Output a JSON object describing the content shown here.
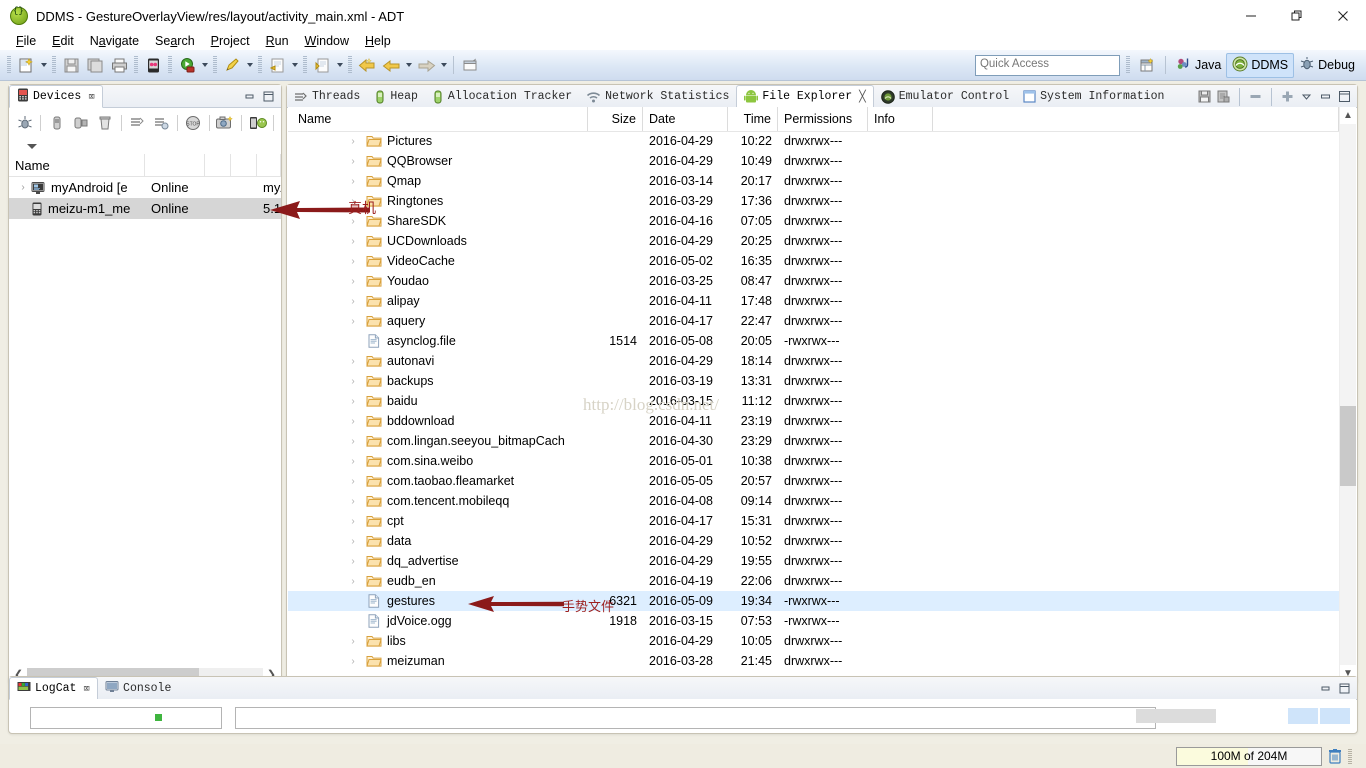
{
  "window": {
    "title": "DDMS - GestureOverlayView/res/layout/activity_main.xml - ADT",
    "minimize": "—",
    "maximize": "❐",
    "close": "✕"
  },
  "menu": [
    {
      "label": "File"
    },
    {
      "label": "Edit"
    },
    {
      "label": "Navigate"
    },
    {
      "label": "Search"
    },
    {
      "label": "Project"
    },
    {
      "label": "Run"
    },
    {
      "label": "Window"
    },
    {
      "label": "Help"
    }
  ],
  "toolbar": {
    "quick_access_placeholder": "Quick Access",
    "perspectives": [
      {
        "label": "Java",
        "active": false,
        "icon": "java-perspective-icon"
      },
      {
        "label": "DDMS",
        "active": true,
        "icon": "ddms-perspective-icon"
      },
      {
        "label": "Debug",
        "active": false,
        "icon": "debug-perspective-icon"
      }
    ]
  },
  "devices_view": {
    "tab_label": "Devices",
    "close_glyph": "⌧",
    "columns": [
      "Name",
      "",
      "",
      "",
      ""
    ],
    "rows": [
      {
        "name": "myAndroid [e",
        "status": "Online",
        "col3": "",
        "col4": "",
        "info": "myA",
        "twisty": "›",
        "icon": "emulator-icon",
        "selected": false
      },
      {
        "name": "meizu-m1_me",
        "status": "Online",
        "col3": "",
        "col4": "",
        "info": "5.1",
        "twisty": "",
        "icon": "phone-icon",
        "selected": true
      }
    ]
  },
  "explorer_view": {
    "tabs": [
      {
        "label": "Threads",
        "icon": "threads-icon",
        "active": false
      },
      {
        "label": "Heap",
        "icon": "heap-icon",
        "active": false
      },
      {
        "label": "Allocation Tracker",
        "icon": "allocation-icon",
        "active": false
      },
      {
        "label": "Network Statistics",
        "icon": "network-icon",
        "active": false
      },
      {
        "label": "File Explorer",
        "icon": "android-icon",
        "active": true
      },
      {
        "label": "Emulator Control",
        "icon": "emulator-control-icon",
        "active": false
      },
      {
        "label": "System Information",
        "icon": "system-info-icon",
        "active": false
      }
    ],
    "columns": {
      "name": "Name",
      "size": "Size",
      "date": "Date",
      "time": "Time",
      "permissions": "Permissions",
      "info": "Info"
    },
    "rows": [
      {
        "name": "Pictures",
        "size": "",
        "date": "2016-04-29",
        "time": "10:22",
        "perm": "drwxrwx---",
        "type": "folder",
        "selected": false
      },
      {
        "name": "QQBrowser",
        "size": "",
        "date": "2016-04-29",
        "time": "10:49",
        "perm": "drwxrwx---",
        "type": "folder",
        "selected": false
      },
      {
        "name": "Qmap",
        "size": "",
        "date": "2016-03-14",
        "time": "20:17",
        "perm": "drwxrwx---",
        "type": "folder",
        "selected": false
      },
      {
        "name": "Ringtones",
        "size": "",
        "date": "2016-03-29",
        "time": "17:36",
        "perm": "drwxrwx---",
        "type": "folder",
        "selected": false
      },
      {
        "name": "ShareSDK",
        "size": "",
        "date": "2016-04-16",
        "time": "07:05",
        "perm": "drwxrwx---",
        "type": "folder",
        "selected": false
      },
      {
        "name": "UCDownloads",
        "size": "",
        "date": "2016-04-29",
        "time": "20:25",
        "perm": "drwxrwx---",
        "type": "folder",
        "selected": false
      },
      {
        "name": "VideoCache",
        "size": "",
        "date": "2016-05-02",
        "time": "16:35",
        "perm": "drwxrwx---",
        "type": "folder",
        "selected": false
      },
      {
        "name": "Youdao",
        "size": "",
        "date": "2016-03-25",
        "time": "08:47",
        "perm": "drwxrwx---",
        "type": "folder",
        "selected": false
      },
      {
        "name": "alipay",
        "size": "",
        "date": "2016-04-11",
        "time": "17:48",
        "perm": "drwxrwx---",
        "type": "folder",
        "selected": false
      },
      {
        "name": "aquery",
        "size": "",
        "date": "2016-04-17",
        "time": "22:47",
        "perm": "drwxrwx---",
        "type": "folder",
        "selected": false
      },
      {
        "name": "asynclog.file",
        "size": "1514",
        "date": "2016-05-08",
        "time": "20:05",
        "perm": "-rwxrwx---",
        "type": "file",
        "selected": false
      },
      {
        "name": "autonavi",
        "size": "",
        "date": "2016-04-29",
        "time": "18:14",
        "perm": "drwxrwx---",
        "type": "folder",
        "selected": false
      },
      {
        "name": "backups",
        "size": "",
        "date": "2016-03-19",
        "time": "13:31",
        "perm": "drwxrwx---",
        "type": "folder",
        "selected": false
      },
      {
        "name": "baidu",
        "size": "",
        "date": "2016-03-15",
        "time": "11:12",
        "perm": "drwxrwx---",
        "type": "folder",
        "selected": false
      },
      {
        "name": "bddownload",
        "size": "",
        "date": "2016-04-11",
        "time": "23:19",
        "perm": "drwxrwx---",
        "type": "folder",
        "selected": false
      },
      {
        "name": "com.lingan.seeyou_bitmapCach",
        "size": "",
        "date": "2016-04-30",
        "time": "23:29",
        "perm": "drwxrwx---",
        "type": "folder",
        "selected": false
      },
      {
        "name": "com.sina.weibo",
        "size": "",
        "date": "2016-05-01",
        "time": "10:38",
        "perm": "drwxrwx---",
        "type": "folder",
        "selected": false
      },
      {
        "name": "com.taobao.fleamarket",
        "size": "",
        "date": "2016-05-05",
        "time": "20:57",
        "perm": "drwxrwx---",
        "type": "folder",
        "selected": false
      },
      {
        "name": "com.tencent.mobileqq",
        "size": "",
        "date": "2016-04-08",
        "time": "09:14",
        "perm": "drwxrwx---",
        "type": "folder",
        "selected": false
      },
      {
        "name": "cpt",
        "size": "",
        "date": "2016-04-17",
        "time": "15:31",
        "perm": "drwxrwx---",
        "type": "folder",
        "selected": false
      },
      {
        "name": "data",
        "size": "",
        "date": "2016-04-29",
        "time": "10:52",
        "perm": "drwxrwx---",
        "type": "folder",
        "selected": false
      },
      {
        "name": "dq_advertise",
        "size": "",
        "date": "2016-04-29",
        "time": "19:55",
        "perm": "drwxrwx---",
        "type": "folder",
        "selected": false
      },
      {
        "name": "eudb_en",
        "size": "",
        "date": "2016-04-19",
        "time": "22:06",
        "perm": "drwxrwx---",
        "type": "folder",
        "selected": false
      },
      {
        "name": "gestures",
        "size": "6321",
        "date": "2016-05-09",
        "time": "19:34",
        "perm": "-rwxrwx---",
        "type": "file",
        "selected": true
      },
      {
        "name": "jdVoice.ogg",
        "size": "1918",
        "date": "2016-03-15",
        "time": "07:53",
        "perm": "-rwxrwx---",
        "type": "file",
        "selected": false
      },
      {
        "name": "libs",
        "size": "",
        "date": "2016-04-29",
        "time": "10:05",
        "perm": "drwxrwx---",
        "type": "folder",
        "selected": false
      },
      {
        "name": "meizuman",
        "size": "",
        "date": "2016-03-28",
        "time": "21:45",
        "perm": "drwxrwx---",
        "type": "folder",
        "selected": false
      }
    ]
  },
  "logcat_view": {
    "tabs": [
      {
        "label": "LogCat",
        "icon": "logcat-icon",
        "active": true,
        "close_glyph": "⌧"
      },
      {
        "label": "Console",
        "icon": "console-icon",
        "active": false,
        "close_glyph": ""
      }
    ]
  },
  "statusbar": {
    "heap_label": "100M of 204M",
    "heap_used_percent": 49,
    "trash_icon": "trash-icon"
  },
  "annotations": [
    {
      "id": "device-arrow-label",
      "text": "真机"
    },
    {
      "id": "gestures-arrow-label",
      "text": "手势文件"
    }
  ],
  "watermark": {
    "text": "http://blog.csdn.net/"
  },
  "colors": {
    "accent_blue": "#cfe3fa",
    "selection_blue": "#ddeeff",
    "annotation_red": "#9c1f1f",
    "folder_yellow": "#e8b55b"
  }
}
